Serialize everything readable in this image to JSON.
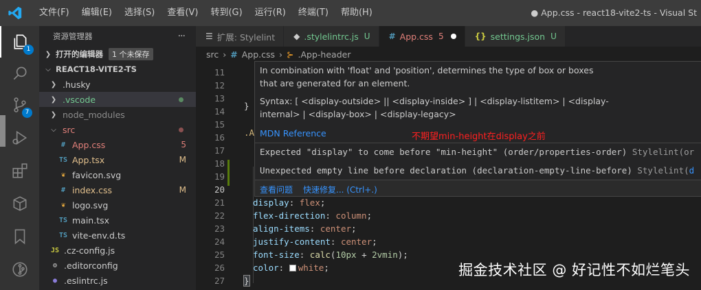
{
  "titlebar": {
    "menu": [
      "文件(F)",
      "编辑(E)",
      "选择(S)",
      "查看(V)",
      "转到(G)",
      "运行(R)",
      "终端(T)",
      "帮助(H)"
    ],
    "window_title": "● App.css - react18-vite2-ts - Visual St"
  },
  "activity": {
    "explorer_badge": "1",
    "scm_badge": "7"
  },
  "sidebar": {
    "title": "资源管理器",
    "more": "···",
    "open_editors": "打开的编辑器",
    "unsaved": "1 个未保存",
    "project": "REACT18-VITE2-TS",
    "items": [
      {
        "label": ".husky",
        "type": "folder-closed",
        "indent": 1,
        "color": "#cccccc",
        "status": ""
      },
      {
        "label": ".vscode",
        "type": "folder-closed",
        "indent": 1,
        "color": "#73c991",
        "status": "dot-green",
        "selected": true
      },
      {
        "label": "node_modules",
        "type": "folder-closed",
        "indent": 1,
        "color": "#8c8c8c",
        "status": ""
      },
      {
        "label": "src",
        "type": "folder-open",
        "indent": 1,
        "color": "#e2807a",
        "status": "dot-red"
      },
      {
        "label": "App.css",
        "icon": "#",
        "iconColor": "#519aba",
        "indent": 2,
        "color": "#e2807a",
        "status": "5",
        "statusColor": "#e2807a"
      },
      {
        "label": "App.tsx",
        "icon": "TS",
        "iconColor": "#519aba",
        "indent": 2,
        "color": "#e2c08d",
        "status": "M",
        "statusColor": "#e2c08d"
      },
      {
        "label": "favicon.svg",
        "icon": "❦",
        "iconColor": "#f0b040",
        "indent": 2,
        "color": "#cccccc",
        "status": ""
      },
      {
        "label": "index.css",
        "icon": "#",
        "iconColor": "#519aba",
        "indent": 2,
        "color": "#e2c08d",
        "status": "M",
        "statusColor": "#e2c08d"
      },
      {
        "label": "logo.svg",
        "icon": "❦",
        "iconColor": "#f0b040",
        "indent": 2,
        "color": "#cccccc",
        "status": ""
      },
      {
        "label": "main.tsx",
        "icon": "TS",
        "iconColor": "#519aba",
        "indent": 2,
        "color": "#cccccc",
        "status": ""
      },
      {
        "label": "vite-env.d.ts",
        "icon": "TS",
        "iconColor": "#519aba",
        "indent": 2,
        "color": "#cccccc",
        "status": ""
      },
      {
        "label": ".cz-config.js",
        "icon": "JS",
        "iconColor": "#cbcb41",
        "indent": 1,
        "color": "#cccccc",
        "status": ""
      },
      {
        "label": ".editorconfig",
        "icon": "⚙",
        "iconColor": "#cccccc",
        "indent": 1,
        "color": "#cccccc",
        "status": ""
      },
      {
        "label": ".eslintrc.js",
        "icon": "●",
        "iconColor": "#8a7cd8",
        "indent": 1,
        "color": "#cccccc",
        "status": ""
      }
    ]
  },
  "tabs": [
    {
      "label": "扩展: Stylelint",
      "icon": "☰",
      "iconColor": "#cccccc",
      "suffix": "",
      "active": false
    },
    {
      "label": ".stylelintrc.js",
      "icon": "◆",
      "iconColor": "#cccccc",
      "suffix": "U",
      "suffixColor": "#73c991",
      "labelColor": "#73c991",
      "active": false
    },
    {
      "label": "App.css",
      "icon": "#",
      "iconColor": "#519aba",
      "suffix": "5",
      "suffixColor": "#e2807a",
      "labelColor": "#e2807a",
      "active": true,
      "dirty": true
    },
    {
      "label": "settings.json",
      "icon": "{}",
      "iconColor": "#cbcb41",
      "suffix": "U",
      "suffixColor": "#73c991",
      "labelColor": "#73c991",
      "active": false
    }
  ],
  "breadcrumb": {
    "folder": "src",
    "sep": "›",
    "file_icon": "#",
    "file": "App.css",
    "symbol_icon": "⊱",
    "symbol": ".App-header"
  },
  "editor": {
    "line_numbers": [
      "11",
      "12",
      "13",
      "14",
      "15",
      "16",
      "17",
      "18",
      "19",
      "20",
      "21",
      "22",
      "23",
      "24",
      "25",
      "26",
      "27"
    ],
    "current_line": "20",
    "partial_lines": {
      "14": "}",
      "16": ".A"
    },
    "code": [
      {
        "line": "21",
        "prop": "display",
        "value": "flex"
      },
      {
        "line": "22",
        "prop": "flex-direction",
        "value": "column"
      },
      {
        "line": "23",
        "prop": "align-items",
        "value": "center"
      },
      {
        "line": "24",
        "prop": "justify-content",
        "value": "center"
      },
      {
        "line": "25",
        "prop": "font-size",
        "fn": "calc",
        "arg1": "10px",
        "op": " + ",
        "arg2": "2vmin"
      },
      {
        "line": "26",
        "prop": "color",
        "value": "white",
        "swatch": "#ffffff"
      }
    ],
    "closing_brace": "}"
  },
  "hover": {
    "desc_line1": "In combination with 'float' and 'position', determines the type of box or boxes",
    "desc_line2": "that are generated for an element.",
    "syntax_line1": "Syntax: [ <display-outside> || <display-inside> ] | <display-listitem> | <display-",
    "syntax_line2": "internal> | <display-box> | <display-legacy>",
    "mdn": "MDN Reference",
    "annotation": "不期望min-height在display之前",
    "problem1_text": "Expected \"display\" to come before \"min-height\" (order/properties-order) ",
    "problem1_source": "Stylelint(or",
    "problem2_text": "Unexpected empty line before declaration (declaration-empty-line-before) ",
    "problem2_source": "Stylelint(",
    "problem2_link": "d",
    "action_view": "查看问题",
    "action_fix": "快速修复... (Ctrl+.)"
  },
  "watermark": "掘金技术社区 @ 好记性不如烂笔头"
}
